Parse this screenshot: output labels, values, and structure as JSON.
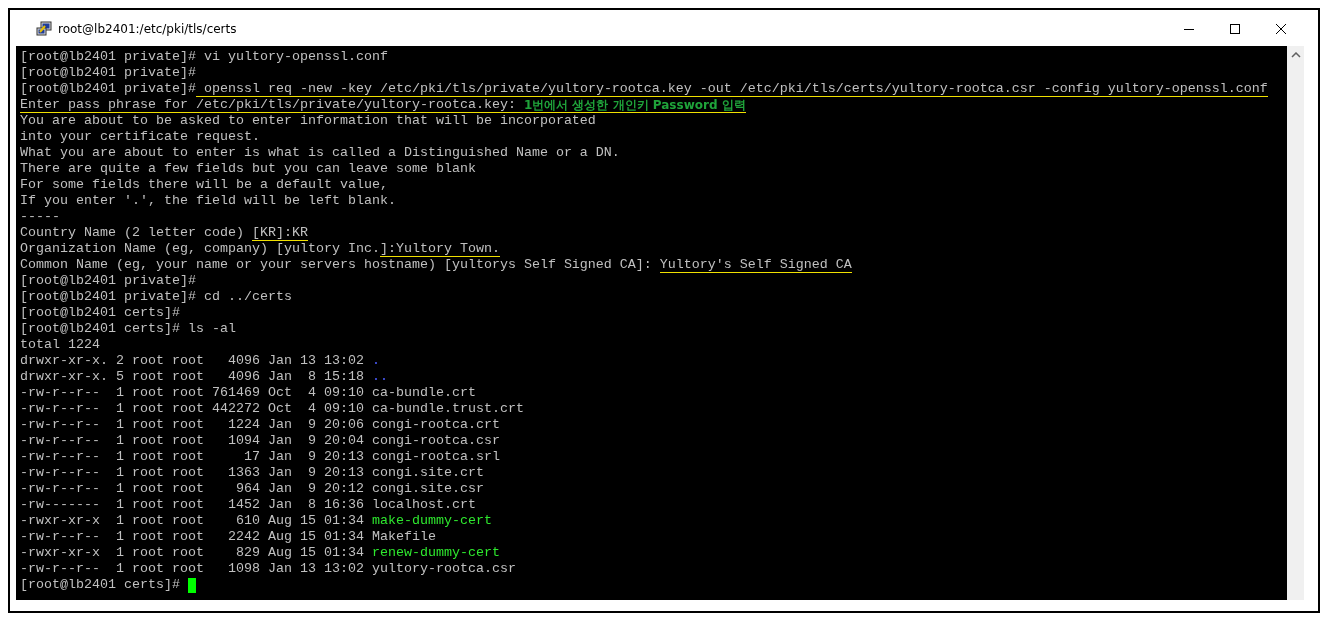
{
  "window": {
    "title": "root@lb2401:/etc/pki/tls/certs"
  },
  "terminal": {
    "lines": [
      [
        {
          "kind": "text",
          "text": "[root@lb2401 private]# vi yultory-openssl.conf",
          "marked": false
        }
      ],
      [
        {
          "kind": "text",
          "text": "[root@lb2401 private]#",
          "marked": false
        }
      ],
      [
        {
          "kind": "text",
          "text": "[root@lb2401 private]#",
          "marked": false
        },
        {
          "kind": "text",
          "text": " openssl req -new -key /etc/pki/tls/private/yultory-rootca.key -out /etc/pki/tls/certs/yultory-rootca.csr -config yultory-openssl.conf",
          "marked": true
        }
      ],
      [
        {
          "kind": "text",
          "text": "Enter pass phrase for /etc/pki/tls/private/yultory-rootca.key: ",
          "marked": true
        },
        {
          "kind": "note",
          "text": "1번에서 생성한 개인키 Password 입력",
          "marked": true
        }
      ],
      [
        {
          "kind": "text",
          "text": "You are about to be asked to enter information that will be incorporated",
          "marked": false
        }
      ],
      [
        {
          "kind": "text",
          "text": "into your certificate request.",
          "marked": false
        }
      ],
      [
        {
          "kind": "text",
          "text": "What you are about to enter is what is called a Distinguished Name or a DN.",
          "marked": false
        }
      ],
      [
        {
          "kind": "text",
          "text": "There are quite a few fields but you can leave some blank",
          "marked": false
        }
      ],
      [
        {
          "kind": "text",
          "text": "For some fields there will be a default value,",
          "marked": false
        }
      ],
      [
        {
          "kind": "text",
          "text": "If you enter '.', the field will be left blank.",
          "marked": false
        }
      ],
      [
        {
          "kind": "text",
          "text": "-----",
          "marked": false
        }
      ],
      [
        {
          "kind": "text",
          "text": "Country Name (2 letter code) ",
          "marked": false
        },
        {
          "kind": "text",
          "text": "[KR]:KR",
          "marked": true
        }
      ],
      [
        {
          "kind": "text",
          "text": "Organization Name (eg, company) [yultory Inc.",
          "marked": false
        },
        {
          "kind": "text",
          "text": "]:Yultory Town.",
          "marked": true
        }
      ],
      [
        {
          "kind": "text",
          "text": "Common Name (eg, your name or your servers hostname) [yultorys Self Signed CA]: ",
          "marked": false
        },
        {
          "kind": "text",
          "text": "Yultory's Self Signed CA",
          "marked": true
        }
      ],
      [
        {
          "kind": "text",
          "text": "[root@lb2401 private]#",
          "marked": false
        }
      ],
      [
        {
          "kind": "text",
          "text": "[root@lb2401 private]# cd ../certs",
          "marked": false
        }
      ],
      [
        {
          "kind": "text",
          "text": "[root@lb2401 certs]#",
          "marked": false
        }
      ],
      [
        {
          "kind": "text",
          "text": "[root@lb2401 certs]# ls -al",
          "marked": false
        }
      ],
      [
        {
          "kind": "text",
          "text": "total 1224",
          "marked": false
        }
      ],
      [
        {
          "kind": "text",
          "text": "drwxr-xr-x. 2 root root   4096 Jan 13 13:02 ",
          "marked": false
        },
        {
          "kind": "dir",
          "text": ".",
          "marked": false
        }
      ],
      [
        {
          "kind": "text",
          "text": "drwxr-xr-x. 5 root root   4096 Jan  8 15:18 ",
          "marked": false
        },
        {
          "kind": "dir",
          "text": "..",
          "marked": false
        }
      ],
      [
        {
          "kind": "text",
          "text": "-rw-r--r--  1 root root 761469 Oct  4 09:10 ca-bundle.crt",
          "marked": false
        }
      ],
      [
        {
          "kind": "text",
          "text": "-rw-r--r--  1 root root 442272 Oct  4 09:10 ca-bundle.trust.crt",
          "marked": false
        }
      ],
      [
        {
          "kind": "text",
          "text": "-rw-r--r--  1 root root   1224 Jan  9 20:06 congi-rootca.crt",
          "marked": false
        }
      ],
      [
        {
          "kind": "text",
          "text": "-rw-r--r--  1 root root   1094 Jan  9 20:04 congi-rootca.csr",
          "marked": false
        }
      ],
      [
        {
          "kind": "text",
          "text": "-rw-r--r--  1 root root     17 Jan  9 20:13 congi-rootca.srl",
          "marked": false
        }
      ],
      [
        {
          "kind": "text",
          "text": "-rw-r--r--  1 root root   1363 Jan  9 20:13 congi.site.crt",
          "marked": false
        }
      ],
      [
        {
          "kind": "text",
          "text": "-rw-r--r--  1 root root    964 Jan  9 20:12 congi.site.csr",
          "marked": false
        }
      ],
      [
        {
          "kind": "text",
          "text": "-rw-------  1 root root   1452 Jan  8 16:36 localhost.crt",
          "marked": false
        }
      ],
      [
        {
          "kind": "text",
          "text": "-rwxr-xr-x  1 root root    610 Aug 15 01:34 ",
          "marked": false
        },
        {
          "kind": "exec",
          "text": "make-dummy-cert",
          "marked": false
        }
      ],
      [
        {
          "kind": "text",
          "text": "-rw-r--r--  1 root root   2242 Aug 15 01:34 Makefile",
          "marked": false
        }
      ],
      [
        {
          "kind": "text",
          "text": "-rwxr-xr-x  1 root root    829 Aug 15 01:34 ",
          "marked": false
        },
        {
          "kind": "exec",
          "text": "renew-dummy-cert",
          "marked": false
        }
      ],
      [
        {
          "kind": "text",
          "text": "-rw-r--r--  1 root root   1098 Jan 13 13:02 yultory-rootca.csr",
          "marked": false
        }
      ],
      [
        {
          "kind": "text",
          "text": "[root@lb2401 certs]# ",
          "marked": false
        }
      ]
    ]
  }
}
